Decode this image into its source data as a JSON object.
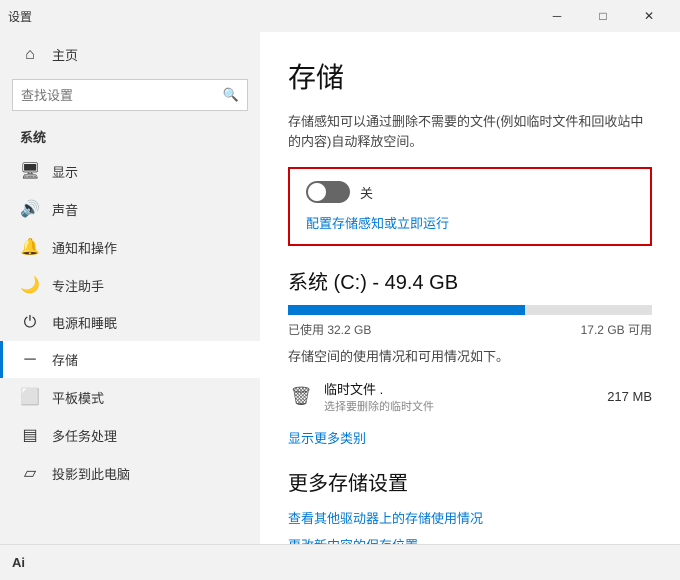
{
  "titlebar": {
    "title": "设置",
    "minimize_label": "─",
    "maximize_label": "□",
    "close_label": "✕"
  },
  "sidebar": {
    "search_placeholder": "查找设置",
    "group_label": "系统",
    "items": [
      {
        "id": "home",
        "icon": "⌂",
        "label": "主页"
      },
      {
        "id": "display",
        "icon": "🖥",
        "label": "显示"
      },
      {
        "id": "sound",
        "icon": "🔊",
        "label": "声音"
      },
      {
        "id": "notify",
        "icon": "🔔",
        "label": "通知和操作"
      },
      {
        "id": "focus",
        "icon": "🌙",
        "label": "专注助手"
      },
      {
        "id": "power",
        "icon": "⏻",
        "label": "电源和睡眠"
      },
      {
        "id": "storage",
        "icon": "−",
        "label": "存储"
      },
      {
        "id": "tablet",
        "icon": "⬜",
        "label": "平板模式"
      },
      {
        "id": "multitask",
        "icon": "▤",
        "label": "多任务处理"
      },
      {
        "id": "project",
        "icon": "▱",
        "label": "投影到此电脑"
      }
    ]
  },
  "main": {
    "page_title": "存储",
    "page_desc": "存储感知可以通过删除不需要的文件(例如临时文件和回收站中的内容)自动释放空间。",
    "toggle_state": "关",
    "configure_link": "配置存储感知或立即运行",
    "drive": {
      "title": "系统 (C:) - 49.4 GB",
      "used_label": "已使用 32.2 GB",
      "free_label": "17.2 GB 可用",
      "fill_percent": 65,
      "desc": "存储空间的使用情况和可用情况如下。",
      "files": [
        {
          "icon": "🗑",
          "name": "临时文件",
          "dots": ".",
          "sub_label": "选择要删除的临时文件",
          "size": "217 MB"
        }
      ],
      "show_more_label": "显示更多类别"
    },
    "more_storage": {
      "title": "更多存储设置",
      "links": [
        "查看其他驱动器上的存储使用情况",
        "更改新内容的保存位置"
      ]
    }
  },
  "bottom": {
    "ai_label": "Ai"
  }
}
